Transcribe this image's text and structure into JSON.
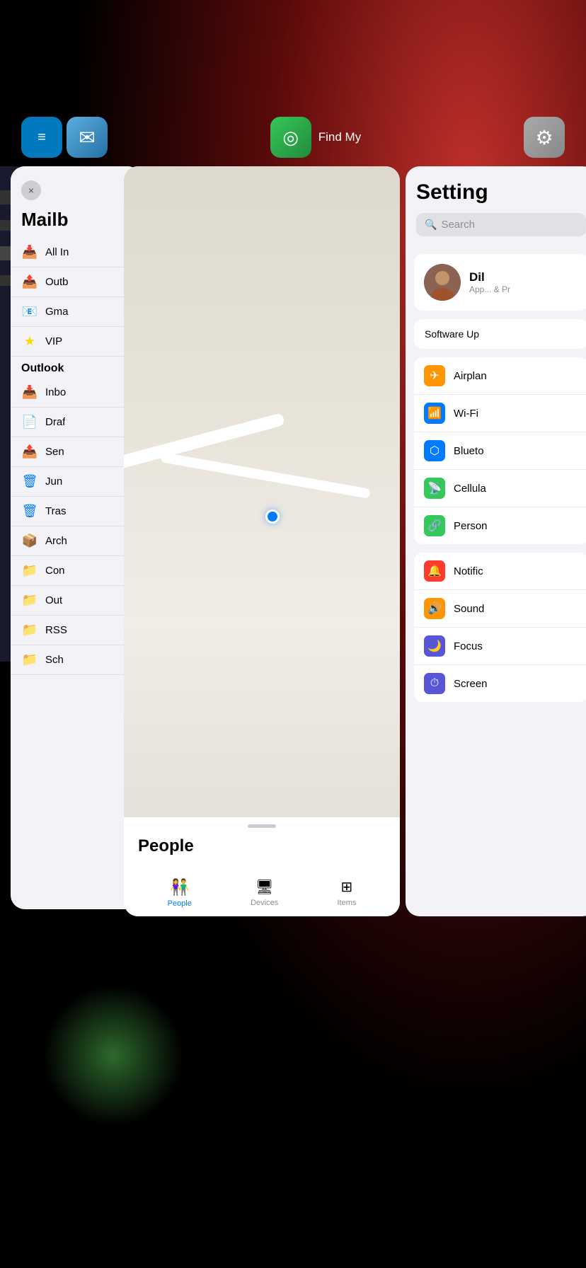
{
  "background": {
    "description": "iOS app switcher with blurred background"
  },
  "app_icons": [
    {
      "name": "Trello",
      "icon": "🗂"
    },
    {
      "name": "Mail",
      "icon": "✉️"
    },
    {
      "name": "Find My",
      "icon": "📍"
    },
    {
      "name": "Settings",
      "icon": "⚙️"
    }
  ],
  "mail_window": {
    "title": "Mailb",
    "close_label": "×",
    "smart_mailboxes": [
      {
        "icon": "📥",
        "label": "All In"
      },
      {
        "icon": "📤",
        "label": "Outb"
      },
      {
        "icon": "📧",
        "label": "Gma"
      },
      {
        "icon": "⭐",
        "label": "VIP"
      }
    ],
    "outlook_section": "Outlook",
    "outlook_items": [
      {
        "icon": "📥",
        "label": "Inbo"
      },
      {
        "icon": "📄",
        "label": "Draf"
      },
      {
        "icon": "📤",
        "label": "Sen"
      },
      {
        "icon": "🗑",
        "label": "Jun"
      },
      {
        "icon": "🗑",
        "label": "Tras"
      },
      {
        "icon": "📦",
        "label": "Arch"
      },
      {
        "icon": "📁",
        "label": "Con"
      },
      {
        "icon": "📁",
        "label": "Out"
      },
      {
        "icon": "📁",
        "label": "RSS"
      },
      {
        "icon": "📁",
        "label": "Sch"
      }
    ]
  },
  "findmy_window": {
    "section_title": "People",
    "tabs": [
      {
        "label": "People",
        "active": true
      },
      {
        "label": "Devices",
        "active": false
      },
      {
        "label": "Items",
        "active": false
      }
    ]
  },
  "settings_window": {
    "title": "Setting",
    "search_placeholder": "Search",
    "profile_name": "Dil",
    "profile_sub": "App... & Pr",
    "software_update": "Software Up",
    "settings_items": [
      {
        "label": "Airplan",
        "icon": "✈️",
        "color": "#FF9500"
      },
      {
        "label": "Wi-Fi",
        "icon": "📶",
        "color": "#007AFF"
      },
      {
        "label": "Blueto",
        "icon": "🔵",
        "color": "#007AFF"
      },
      {
        "label": "Cellula",
        "icon": "📡",
        "color": "#34C759"
      },
      {
        "label": "Person",
        "icon": "🔗",
        "color": "#34C759"
      }
    ],
    "settings_items2": [
      {
        "label": "Notific",
        "icon": "🔔",
        "color": "#FF3B30"
      },
      {
        "label": "Sound",
        "icon": "🔊",
        "color": "#FF9500"
      },
      {
        "label": "Focus",
        "icon": "🌙",
        "color": "#5856D6"
      },
      {
        "label": "Screen",
        "icon": "⏱",
        "color": "#5856D6"
      }
    ]
  }
}
